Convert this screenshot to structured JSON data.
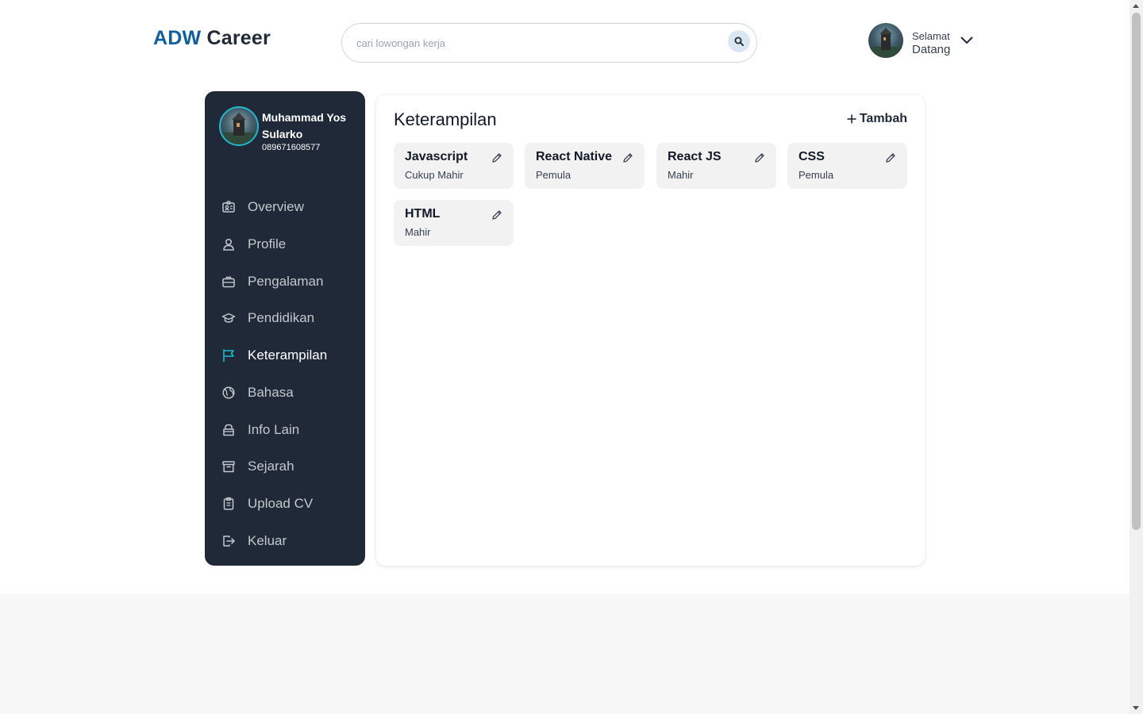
{
  "header": {
    "logo_part1": "ADW",
    "logo_part2": "Career",
    "search_placeholder": "cari lowongan kerja",
    "greeting_line1": "Selamat",
    "greeting_line2": "Datang"
  },
  "sidebar": {
    "user_name": "Muhammad Yos Sularko",
    "user_phone": "089671608577",
    "items": [
      {
        "label": "Overview",
        "icon": "id-card-icon"
      },
      {
        "label": "Profile",
        "icon": "user-icon"
      },
      {
        "label": "Pengalaman",
        "icon": "briefcase-icon"
      },
      {
        "label": "Pendidikan",
        "icon": "graduation-cap-icon"
      },
      {
        "label": "Keterampilan",
        "icon": "flag-icon",
        "active": true
      },
      {
        "label": "Bahasa",
        "icon": "globe-icon"
      },
      {
        "label": "Info Lain",
        "icon": "bag-icon"
      },
      {
        "label": "Sejarah",
        "icon": "archive-icon"
      },
      {
        "label": "Upload CV",
        "icon": "clipboard-icon"
      },
      {
        "label": "Keluar",
        "icon": "logout-icon"
      }
    ]
  },
  "main": {
    "title": "Keterampilan",
    "add_label": "Tambah",
    "skills": [
      {
        "name": "Javascript",
        "level": "Cukup Mahir"
      },
      {
        "name": "React Native",
        "level": "Pemula"
      },
      {
        "name": "React JS",
        "level": "Mahir"
      },
      {
        "name": "CSS",
        "level": "Pemula"
      },
      {
        "name": "HTML",
        "level": "Mahir"
      }
    ]
  },
  "colors": {
    "sidebar_bg": "#1f2937",
    "accent": "#22b8cf",
    "logo_blue": "#0f5f9e"
  }
}
